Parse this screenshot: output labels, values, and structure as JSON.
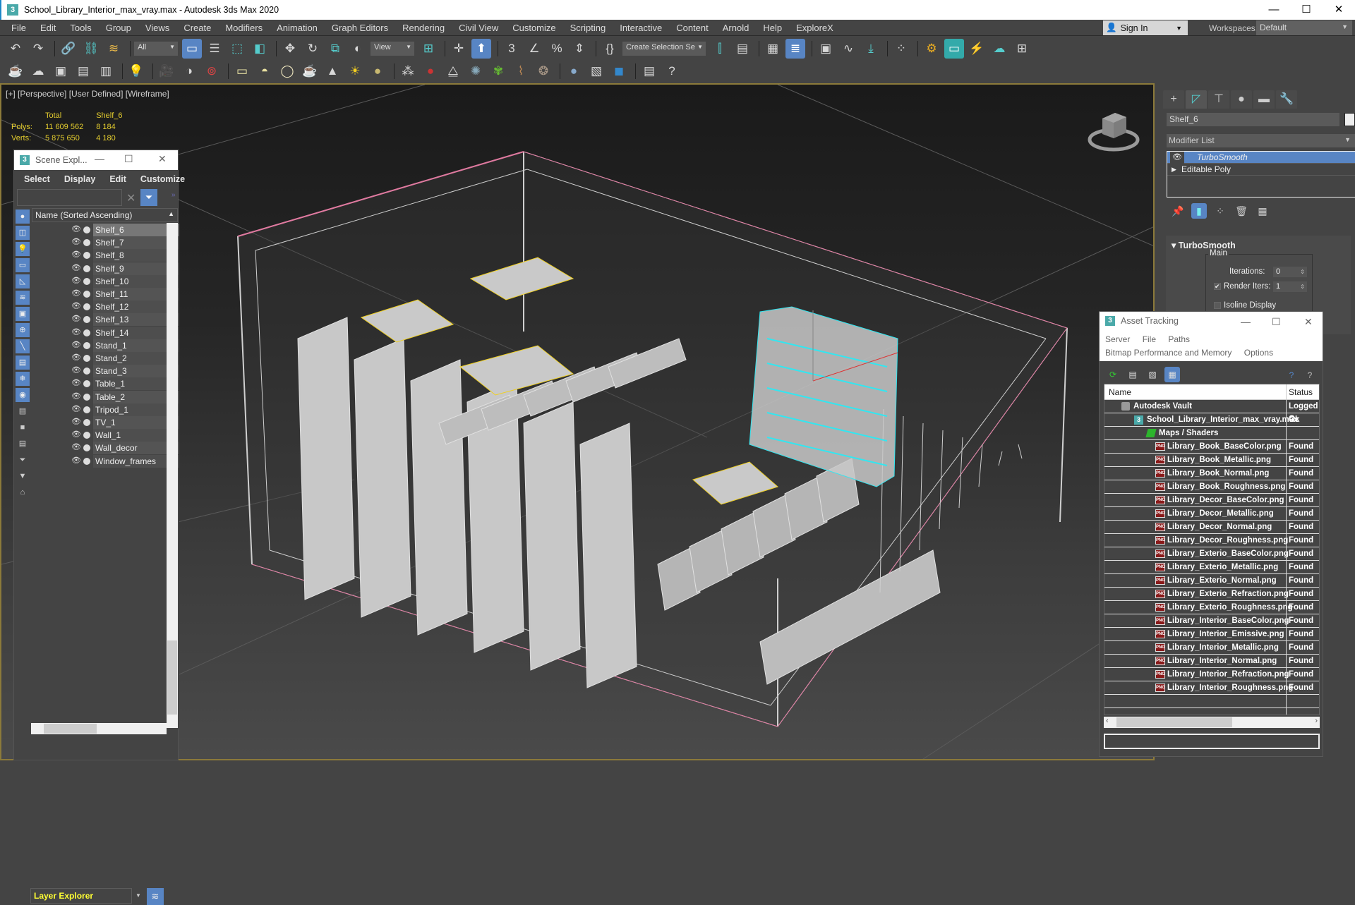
{
  "window": {
    "title": "School_Library_Interior_max_vray.max - Autodesk 3ds Max 2020",
    "app_icon": "3",
    "controls": {
      "minimize": "—",
      "maximize": "☐",
      "close": "✕"
    }
  },
  "menubar": {
    "items": [
      "File",
      "Edit",
      "Tools",
      "Group",
      "Views",
      "Create",
      "Modifiers",
      "Animation",
      "Graph Editors",
      "Rendering",
      "Civil View",
      "Customize",
      "Scripting",
      "Interactive",
      "Content",
      "Arnold",
      "Help",
      "ExploreX"
    ],
    "sign_in": "Sign In",
    "workspaces_label": "Workspaces:",
    "workspace_value": "Default"
  },
  "toolbar1": {
    "selection_filter": "All",
    "reference_coord": "View",
    "named_selection": "Create Selection Se",
    "icons": [
      "undo-icon",
      "redo-icon",
      "link-icon",
      "unlink-icon",
      "bind-space-warp-icon",
      "select-object-icon",
      "select-by-name-icon",
      "rectangular-selection-icon",
      "window-crossing-icon",
      "move-icon",
      "rotate-icon",
      "scale-icon",
      "place-icon",
      "pivot-icon",
      "keyboard-shortcut-override-icon",
      "snaps-toggle-icon",
      "angle-snap-icon",
      "percent-snap-icon",
      "spinner-snap-icon",
      "edit-named-selection-icon",
      "mirror-icon",
      "align-icon",
      "scene-explorer-icon",
      "layer-explorer-icon",
      "toggle-ribbon-icon",
      "curve-editor-icon",
      "schematic-view-icon",
      "material-editor-icon",
      "render-setup-icon",
      "rendered-frame-window-icon",
      "render-production-icon",
      "render-cloud-icon",
      "render-iterative-icon"
    ]
  },
  "viewport": {
    "label": "[+] [Perspective] [User Defined] [Wireframe]",
    "stats": {
      "header_total": "Total",
      "header_selected": "Shelf_6",
      "polys_label": "Polys:",
      "polys_total": "11 609 562",
      "polys_selected": "8 184",
      "verts_label": "Verts:",
      "verts_total": "5 875 650",
      "verts_selected": "4 180"
    }
  },
  "scene_explorer": {
    "title": "Scene Expl...",
    "menu": [
      "Select",
      "Display",
      "Edit",
      "Customize"
    ],
    "search_value": "",
    "column_header": "Name (Sorted Ascending)",
    "items": [
      "Shelf_6",
      "Shelf_7",
      "Shelf_8",
      "Shelf_9",
      "Shelf_10",
      "Shelf_11",
      "Shelf_12",
      "Shelf_13",
      "Shelf_14",
      "Stand_1",
      "Stand_2",
      "Stand_3",
      "Table_1",
      "Table_2",
      "Tripod_1",
      "TV_1",
      "Wall_1",
      "Wall_decor",
      "Window_frames"
    ],
    "selected_item": "Shelf_6",
    "layer_explorer": "Layer Explorer"
  },
  "command_panel": {
    "object_name": "Shelf_6",
    "modifier_list": "Modifier List",
    "stack": [
      {
        "label": "TurboSmooth",
        "selected": true
      },
      {
        "label": "Editable Poly",
        "selected": false
      }
    ],
    "rollout": {
      "title": "TurboSmooth",
      "group": "Main",
      "iterations_label": "Iterations:",
      "iterations_value": "0",
      "render_iters_label": "Render Iters:",
      "render_iters_value": "1",
      "render_iters_checked": true,
      "isoline_label": "Isoline Display",
      "isoline_checked": false
    }
  },
  "asset_tracking": {
    "title": "Asset Tracking",
    "menu_row1": [
      "Server",
      "File",
      "Paths"
    ],
    "menu_row2": [
      "Bitmap Performance and Memory",
      "Options"
    ],
    "columns": {
      "name": "Name",
      "status": "Status"
    },
    "vault": {
      "name": "Autodesk Vault",
      "status": "Logged O"
    },
    "file": {
      "name": "School_Library_Interior_max_vray.max",
      "status": "Ok"
    },
    "maps_group": "Maps / Shaders",
    "maps": [
      {
        "name": "Library_Book_BaseColor.png",
        "status": "Found"
      },
      {
        "name": "Library_Book_Metallic.png",
        "status": "Found"
      },
      {
        "name": "Library_Book_Normal.png",
        "status": "Found"
      },
      {
        "name": "Library_Book_Roughness.png",
        "status": "Found"
      },
      {
        "name": "Library_Decor_BaseColor.png",
        "status": "Found"
      },
      {
        "name": "Library_Decor_Metallic.png",
        "status": "Found"
      },
      {
        "name": "Library_Decor_Normal.png",
        "status": "Found"
      },
      {
        "name": "Library_Decor_Roughness.png",
        "status": "Found"
      },
      {
        "name": "Library_Exterio_BaseColor.png",
        "status": "Found"
      },
      {
        "name": "Library_Exterio_Metallic.png",
        "status": "Found"
      },
      {
        "name": "Library_Exterio_Normal.png",
        "status": "Found"
      },
      {
        "name": "Library_Exterio_Refraction.png",
        "status": "Found"
      },
      {
        "name": "Library_Exterio_Roughness.png",
        "status": "Found"
      },
      {
        "name": "Library_Interior_BaseColor.png",
        "status": "Found"
      },
      {
        "name": "Library_Interior_Emissive.png",
        "status": "Found"
      },
      {
        "name": "Library_Interior_Metallic.png",
        "status": "Found"
      },
      {
        "name": "Library_Interior_Normal.png",
        "status": "Found"
      },
      {
        "name": "Library_Interior_Refraction.png",
        "status": "Found"
      },
      {
        "name": "Library_Interior_Roughness.png",
        "status": "Found"
      }
    ],
    "png_icon_text": "PNG"
  },
  "colors": {
    "accent": "#5885c4",
    "stats_text": "#e3cc2e",
    "selection_wire": "#33e6f0",
    "layer_text": "#ffff33",
    "viewport_border": "#8c7a3a"
  }
}
